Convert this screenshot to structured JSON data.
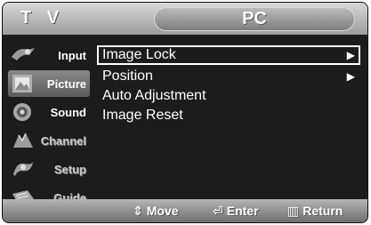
{
  "header": {
    "tv_label": "T V",
    "page_title": "PC"
  },
  "sidebar": {
    "items": [
      {
        "label": "Input",
        "icon": "input-icon",
        "state": "normal"
      },
      {
        "label": "Picture",
        "icon": "picture-icon",
        "state": "active"
      },
      {
        "label": "Sound",
        "icon": "sound-icon",
        "state": "normal"
      },
      {
        "label": "Channel",
        "icon": "channel-icon",
        "state": "dim"
      },
      {
        "label": "Setup",
        "icon": "setup-icon",
        "state": "dim"
      },
      {
        "label": "Guide",
        "icon": "guide-icon",
        "state": "dim"
      }
    ]
  },
  "menu": {
    "items": [
      {
        "label": "Image Lock",
        "arrow": "▶",
        "selected": true
      },
      {
        "label": "Position",
        "arrow": "▶",
        "selected": false
      },
      {
        "label": "Auto Adjustment",
        "arrow": "",
        "selected": false
      },
      {
        "label": "Image Reset",
        "arrow": "",
        "selected": false
      }
    ]
  },
  "footer": {
    "move": "Move",
    "enter": "Enter",
    "return": "Return"
  }
}
